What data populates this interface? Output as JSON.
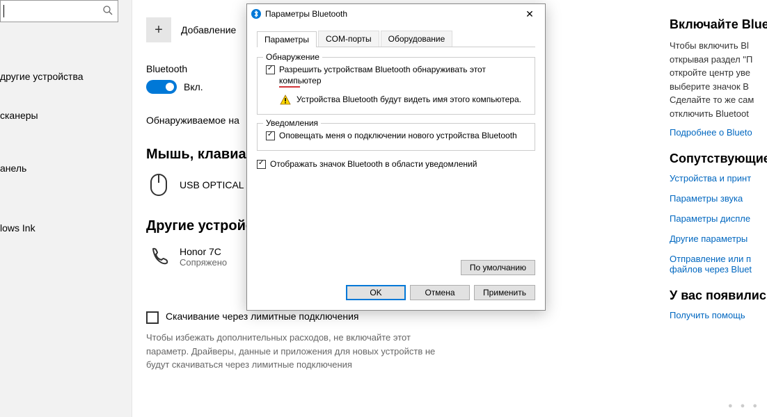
{
  "left": {
    "nav": [
      "другие устройства",
      "сканеры",
      "анель",
      "lows Ink"
    ]
  },
  "main": {
    "add_label": "Добавление",
    "bt_label": "Bluetooth",
    "toggle_text": "Вкл.",
    "visible": "Обнаруживаемое на",
    "mouse_head": "Мышь, клавиату",
    "mouse_dev": "USB OPTICAL",
    "other_head": "Другие устройс",
    "phone_name": "Honor 7C",
    "phone_status": "Сопряжено",
    "metered_chk": "Скачивание через лимитные подключения",
    "metered_desc": "Чтобы избежать дополнительных расходов, не включайте этот параметр. Драйверы, данные и приложения для новых устройств не будут скачиваться через лимитные подключения"
  },
  "right": {
    "head1": "Включайте Bluetoo",
    "text1": "Чтобы включить Bl\nоткрывая раздел \"П\nоткройте центр уве\nвыберите значок В\nСделайте то же сам\nотключить Bluetoot",
    "link1": "Подробнее о Blueto",
    "head2": "Сопутствующие па",
    "links": [
      "Устройства и принт",
      "Параметры звука",
      "Параметры диспле",
      "Другие параметры"
    ],
    "link_send": "Отправление или п\nфайлов через Bluet",
    "head3": "У вас появились в",
    "link_help": "Получить помощь"
  },
  "dialog": {
    "title": "Параметры Bluetooth",
    "tabs": [
      "Параметры",
      "COM-порты",
      "Оборудование"
    ],
    "discovery_legend": "Обнаружение",
    "discovery_chk": "Разрешить устройствам Bluetooth обнаруживать этот компьютер",
    "discovery_warn": "Устройства Bluetooth будут видеть имя этого компьютера.",
    "notif_legend": "Уведомления",
    "notif_chk": "Оповещать меня о подключении нового устройства Bluetooth",
    "tray_chk": "Отображать значок Bluetooth в области уведомлений",
    "default_btn": "По умолчанию",
    "ok": "OK",
    "cancel": "Отмена",
    "apply": "Применить"
  }
}
